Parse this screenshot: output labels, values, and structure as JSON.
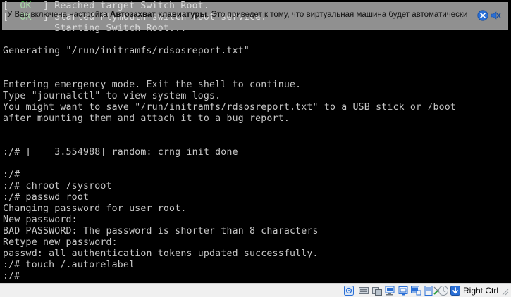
{
  "console": {
    "lines": [
      {
        "prefix": "[  ",
        "ok": "OK",
        "suffix": "  ] Reached target Switch Root."
      },
      {
        "prefix": "[  ",
        "ok": "OK",
        "suffix": "  ] Started Plymouth switch root service."
      },
      {
        "text": "         Starting Switch Root..."
      },
      {
        "text": ""
      },
      {
        "text": "Generating \"/run/initramfs/rdsosreport.txt\""
      },
      {
        "text": ""
      },
      {
        "text": ""
      },
      {
        "text": "Entering emergency mode. Exit the shell to continue."
      },
      {
        "text": "Type \"journalctl\" to view system logs."
      },
      {
        "text": "You might want to save \"/run/initramfs/rdsosreport.txt\" to a USB stick or /boot"
      },
      {
        "text": "after mounting them and attach it to a bug report."
      },
      {
        "text": ""
      },
      {
        "text": ""
      },
      {
        "text": ":/# [    3.554988] random: crng init done"
      },
      {
        "text": ""
      },
      {
        "text": ":/#"
      },
      {
        "text": ":/# chroot /sysroot"
      },
      {
        "text": ":/# passwd root"
      },
      {
        "text": "Changing password for user root."
      },
      {
        "text": "New password:"
      },
      {
        "text": "BAD PASSWORD: The password is shorter than 8 characters"
      },
      {
        "text": "Retype new password:"
      },
      {
        "text": "passwd: all authentication tokens updated successfully."
      },
      {
        "text": ":/# touch /.autorelabel"
      },
      {
        "text": ":/#"
      }
    ]
  },
  "notification": {
    "text_before": "У Вас включена настройка ",
    "text_bold": "Автозахват клавиатуры",
    "text_after": ". Это приведет к тому, что виртуальная машина будет автоматически",
    "info_icon": "info-close-icon",
    "mute_icon": "mute-notifications-icon"
  },
  "statusbar": {
    "icons": [
      "hard-disk-icon",
      "optical-drive-icon",
      "audio-icon",
      "network-icon",
      "usb-icon",
      "shared-folders-icon",
      "display-icon",
      "video-capture-icon",
      "cpu-icon",
      "mouse-integration-icon",
      "keyboard-capture-icon"
    ],
    "host_key_label": "Right Ctrl"
  },
  "colors": {
    "console_bg": "#000000",
    "console_fg": "#c8c8c8",
    "ok_green": "#3fb93f",
    "statusbar_bg": "#f0f0f0",
    "accent_blue": "#2a6fd6"
  }
}
